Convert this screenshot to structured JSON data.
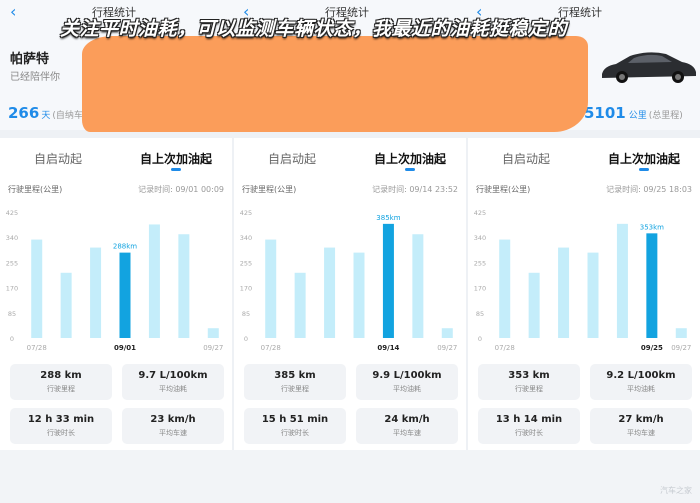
{
  "overlay_caption": "关注平时油耗，可以监测车辆状态，我最近的油耗挺稳定的",
  "header": {
    "back_icon": "‹",
    "titles": [
      "行程统计",
      "行程统计",
      "行程统计"
    ],
    "car_name": "帕萨特",
    "car_subtitle": "已经陪伴你",
    "days_value": "266",
    "days_unit": "天",
    "days_label": "(自纳车",
    "odometer_value": "5101",
    "odometer_unit": "公里",
    "odometer_label": "(总里程)"
  },
  "colors": {
    "accent": "#1f8be8",
    "bar_highlight": "#12a3e0",
    "bar_normal": "#c4edfa",
    "orange_overlay": "#fb9d5a"
  },
  "panels": [
    {
      "tabs": [
        "自启动起",
        "自上次加油起"
      ],
      "active_tab": 1,
      "metric_label": "行驶里程(公里)",
      "record_time": "记录时间: 09/01 00:09",
      "highlight_label": "288km",
      "x_labels": [
        "07/28",
        "09/01",
        "09/27"
      ],
      "stats": [
        {
          "value": "288 km",
          "label": "行驶里程"
        },
        {
          "value": "9.7 L/100km",
          "label": "平均油耗"
        },
        {
          "value": "12 h 33 min",
          "label": "行驶时长"
        },
        {
          "value": "23 km/h",
          "label": "平均车速"
        }
      ]
    },
    {
      "tabs": [
        "自启动起",
        "自上次加油起"
      ],
      "active_tab": 1,
      "metric_label": "行驶里程(公里)",
      "record_time": "记录时间: 09/14 23:52",
      "highlight_label": "385km",
      "x_labels": [
        "07/28",
        "09/14",
        "09/27"
      ],
      "stats": [
        {
          "value": "385 km",
          "label": "行驶里程"
        },
        {
          "value": "9.9 L/100km",
          "label": "平均油耗"
        },
        {
          "value": "15 h 51 min",
          "label": "行驶时长"
        },
        {
          "value": "24 km/h",
          "label": "平均车速"
        }
      ]
    },
    {
      "tabs": [
        "自启动起",
        "自上次加油起"
      ],
      "active_tab": 1,
      "metric_label": "行驶里程(公里)",
      "record_time": "记录时间: 09/25 18:03",
      "highlight_label": "353km",
      "x_labels": [
        "07/28",
        "09/25",
        "09/27"
      ],
      "stats": [
        {
          "value": "353 km",
          "label": "行驶里程"
        },
        {
          "value": "9.2 L/100km",
          "label": "平均油耗"
        },
        {
          "value": "13 h 14 min",
          "label": "行驶时长"
        },
        {
          "value": "27 km/h",
          "label": "平均车速"
        }
      ]
    }
  ],
  "watermark": "汽车之家",
  "chart_data": [
    {
      "type": "bar",
      "ylabel": "行驶里程(公里)",
      "yticks": [
        0,
        85,
        170,
        255,
        340,
        425
      ],
      "ylim": [
        0,
        425
      ],
      "categories": [
        "07/28",
        "",
        "",
        "09/01",
        "",
        "",
        "09/27"
      ],
      "values": [
        332,
        220,
        305,
        288,
        383,
        350,
        33
      ],
      "highlight_index": 3
    },
    {
      "type": "bar",
      "ylabel": "行驶里程(公里)",
      "yticks": [
        0,
        85,
        170,
        255,
        340,
        425
      ],
      "ylim": [
        0,
        425
      ],
      "categories": [
        "07/28",
        "",
        "",
        "",
        "09/14",
        "",
        "09/27"
      ],
      "values": [
        332,
        220,
        305,
        288,
        385,
        350,
        33
      ],
      "highlight_index": 4
    },
    {
      "type": "bar",
      "ylabel": "行驶里程(公里)",
      "yticks": [
        0,
        85,
        170,
        255,
        340,
        425
      ],
      "ylim": [
        0,
        425
      ],
      "categories": [
        "07/28",
        "",
        "",
        "",
        "",
        "09/25",
        "09/27"
      ],
      "values": [
        332,
        220,
        305,
        288,
        385,
        353,
        33
      ],
      "highlight_index": 5
    }
  ]
}
